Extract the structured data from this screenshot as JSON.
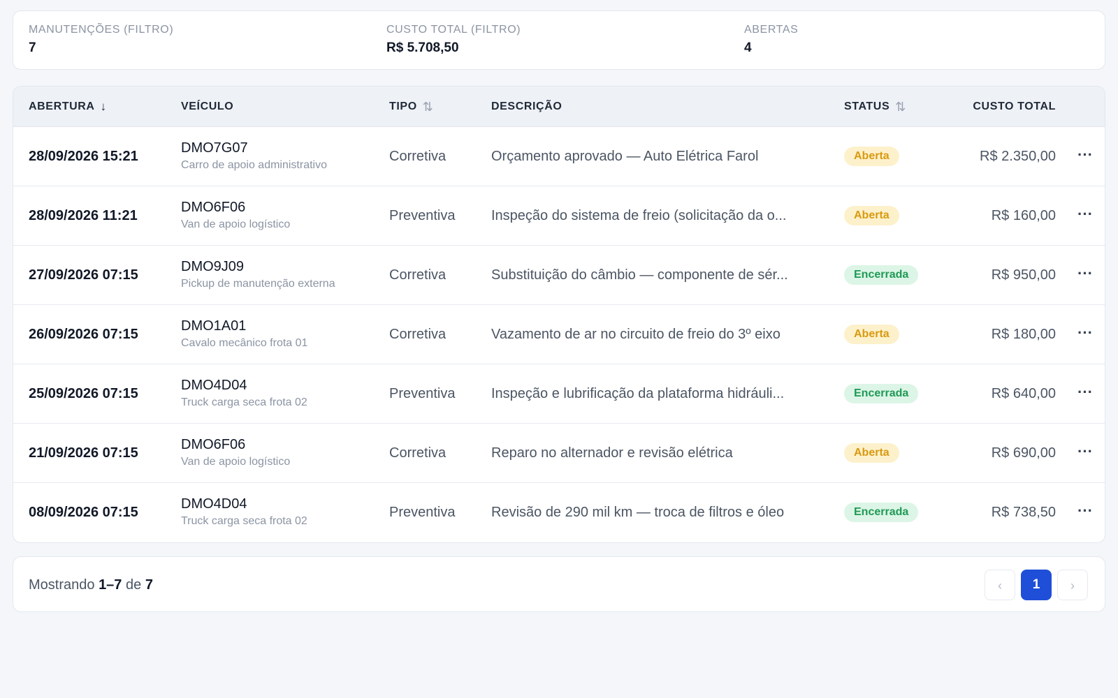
{
  "summary": {
    "maintenances_label": "MANUTENÇÕES (FILTRO)",
    "maintenances_value": "7",
    "total_cost_label": "CUSTO TOTAL (FILTRO)",
    "total_cost_value": "R$ 5.708,50",
    "open_label": "ABERTAS",
    "open_value": "4"
  },
  "table": {
    "headers": {
      "opening": "ABERTURA",
      "vehicle": "VEÍCULO",
      "type": "TIPO",
      "description": "DESCRIÇÃO",
      "status": "STATUS",
      "total_cost": "CUSTO TOTAL"
    },
    "icons": {
      "opening_sort": "arrow-down-icon",
      "type_sort": "sort-icon",
      "status_sort": "sort-icon",
      "row_menu": "more-horizontal-icon"
    },
    "rows": [
      {
        "opening": "28/09/2026 15:21",
        "plate": "DMO7G07",
        "vehicle_desc": "Carro de apoio administrativo",
        "type": "Corretiva",
        "description": "Orçamento aprovado — Auto Elétrica Farol",
        "status": "Aberta",
        "cost": "R$ 2.350,00"
      },
      {
        "opening": "28/09/2026 11:21",
        "plate": "DMO6F06",
        "vehicle_desc": "Van de apoio logístico",
        "type": "Preventiva",
        "description": "Inspeção do sistema de freio (solicitação da o...",
        "status": "Aberta",
        "cost": "R$ 160,00"
      },
      {
        "opening": "27/09/2026 07:15",
        "plate": "DMO9J09",
        "vehicle_desc": "Pickup de manutenção externa",
        "type": "Corretiva",
        "description": "Substituição do câmbio — componente de sér...",
        "status": "Encerrada",
        "cost": "R$ 950,00"
      },
      {
        "opening": "26/09/2026 07:15",
        "plate": "DMO1A01",
        "vehicle_desc": "Cavalo mecânico frota 01",
        "type": "Corretiva",
        "description": "Vazamento de ar no circuito de freio do 3º eixo",
        "status": "Aberta",
        "cost": "R$ 180,00"
      },
      {
        "opening": "25/09/2026 07:15",
        "plate": "DMO4D04",
        "vehicle_desc": "Truck carga seca frota 02",
        "type": "Preventiva",
        "description": "Inspeção e lubrificação da plataforma hidráuli...",
        "status": "Encerrada",
        "cost": "R$ 640,00"
      },
      {
        "opening": "21/09/2026 07:15",
        "plate": "DMO6F06",
        "vehicle_desc": "Van de apoio logístico",
        "type": "Corretiva",
        "description": "Reparo no alternador e revisão elétrica",
        "status": "Aberta",
        "cost": "R$ 690,00"
      },
      {
        "opening": "08/09/2026 07:15",
        "plate": "DMO4D04",
        "vehicle_desc": "Truck carga seca frota 02",
        "type": "Preventiva",
        "description": "Revisão de 290 mil km — troca de filtros e óleo",
        "status": "Encerrada",
        "cost": "R$ 738,50"
      }
    ]
  },
  "pagination": {
    "prefix": "Mostrando",
    "range": "1–7",
    "of": "de",
    "total": "7",
    "current_page": "1",
    "prev_icon": "chevron-left-icon",
    "next_icon": "chevron-right-icon"
  },
  "colors": {
    "accent": "#1f4fd8",
    "status_open_bg": "#fdf1cc",
    "status_open_text": "#d89a10",
    "status_closed_bg": "#dcf5e6",
    "status_closed_text": "#1f9a55"
  }
}
